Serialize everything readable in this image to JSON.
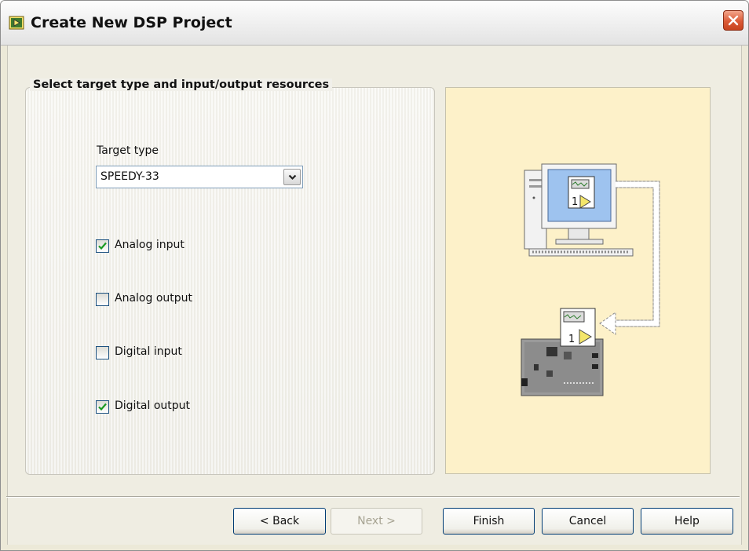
{
  "window": {
    "title": "Create New DSP Project"
  },
  "group": {
    "legend": "Select target type and input/output resources"
  },
  "target": {
    "label": "Target type",
    "value": "SPEEDY-33"
  },
  "checkboxes": [
    {
      "label": "Analog input",
      "checked": true
    },
    {
      "label": "Analog output",
      "checked": false
    },
    {
      "label": "Digital input",
      "checked": false
    },
    {
      "label": "Digital output",
      "checked": true
    }
  ],
  "buttons": {
    "back": "< Back",
    "next": "Next >",
    "finish": "Finish",
    "cancel": "Cancel",
    "help": "Help"
  },
  "illustration": {
    "pc_vi_number": "1",
    "board_vi_number": "1"
  },
  "colors": {
    "illustration_bg": "#fdf1c9",
    "check": "#1a9a22",
    "close": "#db5a36"
  }
}
